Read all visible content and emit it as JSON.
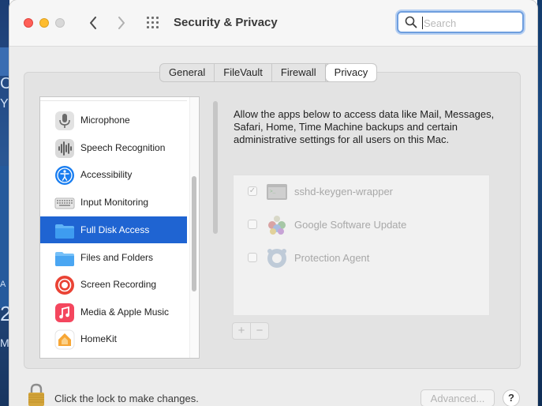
{
  "window": {
    "title": "Security & Privacy"
  },
  "search": {
    "placeholder": "Search",
    "value": ""
  },
  "tabs": [
    {
      "label": "General",
      "active": false
    },
    {
      "label": "FileVault",
      "active": false
    },
    {
      "label": "Firewall",
      "active": false
    },
    {
      "label": "Privacy",
      "active": true
    }
  ],
  "sidebar": {
    "items": [
      {
        "label": "Microphone",
        "icon": "microphone-icon"
      },
      {
        "label": "Speech Recognition",
        "icon": "waveform-icon"
      },
      {
        "label": "Accessibility",
        "icon": "accessibility-icon"
      },
      {
        "label": "Input Monitoring",
        "icon": "keyboard-icon"
      },
      {
        "label": "Full Disk Access",
        "icon": "folder-icon",
        "selected": true
      },
      {
        "label": "Files and Folders",
        "icon": "folder-icon"
      },
      {
        "label": "Screen Recording",
        "icon": "screen-recording-icon"
      },
      {
        "label": "Media & Apple Music",
        "icon": "music-icon"
      },
      {
        "label": "HomeKit",
        "icon": "home-icon"
      }
    ]
  },
  "main": {
    "description": "Allow the apps below to access data like Mail, Messages, Safari, Home, Time Machine backups and certain administrative settings for all users on this Mac.",
    "apps": [
      {
        "name": "sshd-keygen-wrapper",
        "checked": true,
        "icon": "terminal-icon"
      },
      {
        "name": "Google Software Update",
        "checked": false,
        "icon": "google-update-icon"
      },
      {
        "name": "Protection Agent",
        "checked": false,
        "icon": "protection-agent-icon"
      }
    ],
    "add_label": "+",
    "remove_label": "−"
  },
  "footer": {
    "lock_text": "Click the lock to make changes.",
    "advanced_label": "Advanced...",
    "help_label": "?"
  },
  "colors": {
    "selection": "#1f64d2",
    "search_focus": "#6e9ede",
    "close": "#ff5f57",
    "minimize": "#febc2e"
  },
  "desktop": {
    "left_glyphs": [
      "C",
      "Y",
      "A",
      "2",
      "M"
    ]
  }
}
